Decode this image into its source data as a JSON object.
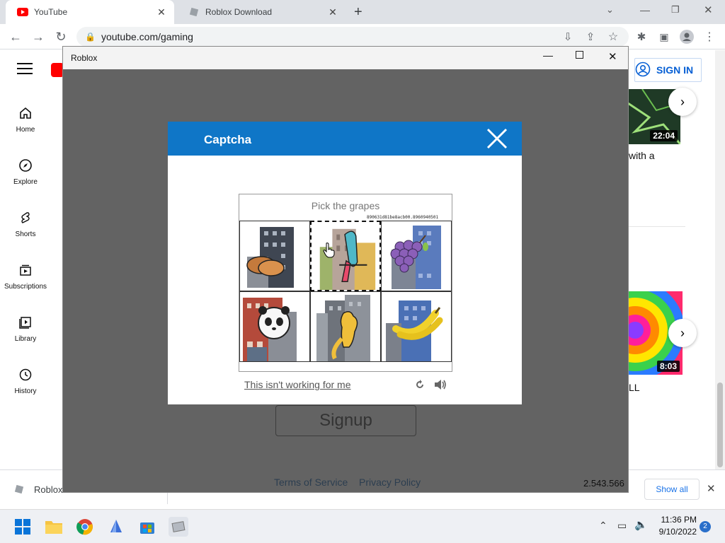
{
  "browser": {
    "tabs": [
      {
        "label": "YouTube"
      },
      {
        "label": "Roblox Download"
      }
    ],
    "url": "youtube.com/gaming"
  },
  "youtube": {
    "sidebar": [
      {
        "label": "Home",
        "icon": "home-icon"
      },
      {
        "label": "Explore",
        "icon": "compass-icon"
      },
      {
        "label": "Shorts",
        "icon": "shorts-icon"
      },
      {
        "label": "Subscriptions",
        "icon": "subscriptions-icon"
      },
      {
        "label": "Library",
        "icon": "library-icon"
      },
      {
        "label": "History",
        "icon": "history-icon"
      }
    ],
    "sign_in": "SIGN IN",
    "video1": {
      "duration": "22:04",
      "title_fragment": "with a"
    },
    "video2": {
      "duration": "8:03",
      "title_fragment": "LL"
    }
  },
  "roblox_window": {
    "title": "Roblox",
    "signup": "Signup",
    "terms": "Terms of Service",
    "privacy": "Privacy Policy",
    "version": "2.543.566"
  },
  "captcha": {
    "title": "Captcha",
    "prompt": "Pick the grapes",
    "token": "890631d81be8acb00.8960940501",
    "help_link": "This isn't working for me",
    "tiles": [
      {
        "subject": "bread"
      },
      {
        "subject": "parrot",
        "selected": true
      },
      {
        "subject": "grapes"
      },
      {
        "subject": "panda"
      },
      {
        "subject": "kangaroo"
      },
      {
        "subject": "bananas"
      }
    ]
  },
  "downloads": {
    "item": "Roblox",
    "show_all": "Show all"
  },
  "taskbar": {
    "time": "11:36 PM",
    "date": "9/10/2022",
    "badge": "2"
  }
}
